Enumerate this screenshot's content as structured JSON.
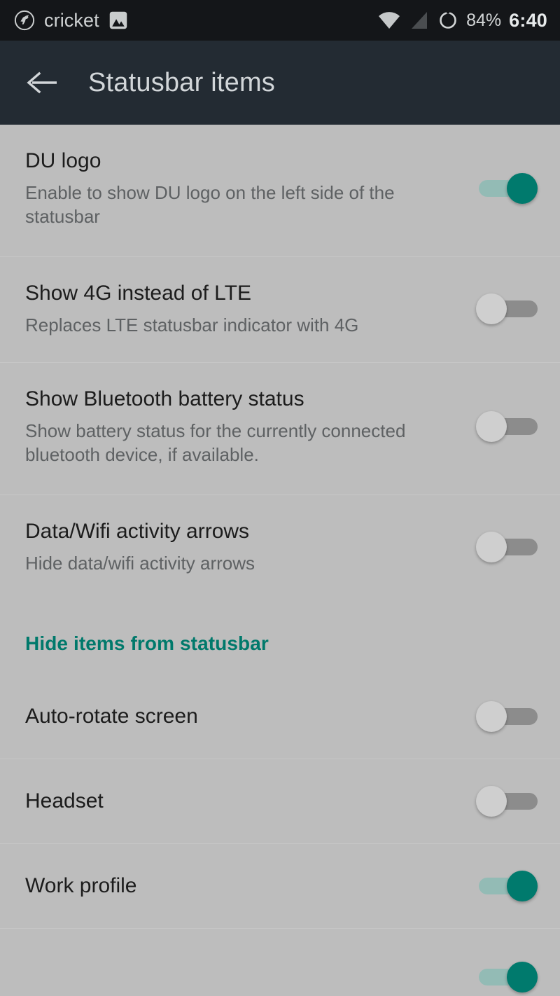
{
  "statusbar": {
    "logo_icon": "du-unicorn-logo-icon",
    "carrier": "cricket",
    "screenshot_icon": "image-screenshot-icon",
    "wifi_icon": "wifi-signal-icon",
    "cellular_icon": "cellular-signal-icon",
    "battery_icon": "battery-circle-icon",
    "battery_percent": "84%",
    "clock": "6:40"
  },
  "toolbar": {
    "back_icon": "back-arrow-icon",
    "title": "Statusbar items"
  },
  "colors": {
    "statusbar_bg": "#141619",
    "toolbar_bg": "#232b33",
    "page_bg": "#bdbdbd",
    "accent_teal": "#00796b",
    "switch_on_thumb": "#007a6d",
    "switch_on_track": "#93bbb5",
    "switch_off_thumb": "#cfcfcf",
    "switch_off_track": "#8c8c8c",
    "title_text": "#1c1c1c",
    "summary_text": "#5e6163",
    "divider": "#b0b0b0"
  },
  "preferences": [
    {
      "title": "DU logo",
      "summary": "Enable to show DU logo on the left side of the statusbar",
      "checked": true,
      "state_label": "On"
    },
    {
      "title": "Show 4G instead of LTE",
      "summary": "Replaces LTE statusbar indicator with 4G",
      "checked": false,
      "state_label": "Off"
    },
    {
      "title": "Show Bluetooth battery status",
      "summary": "Show battery status for the currently connected bluetooth device, if available.",
      "checked": false,
      "state_label": "Off"
    },
    {
      "title": "Data/Wifi activity arrows",
      "summary": "Hide data/wifi activity arrows",
      "checked": false,
      "state_label": "Off"
    }
  ],
  "section": {
    "header": "Hide items from statusbar",
    "items": [
      {
        "title": "Auto-rotate screen",
        "checked": false,
        "state_label": "Off"
      },
      {
        "title": "Headset",
        "checked": false,
        "state_label": "Off"
      },
      {
        "title": "Work profile",
        "checked": true,
        "state_label": "On"
      }
    ]
  }
}
